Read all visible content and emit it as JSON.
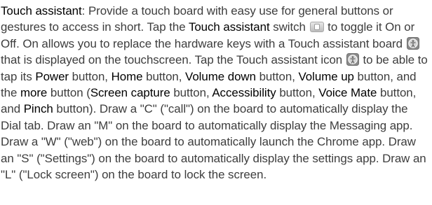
{
  "segments": [
    {
      "t": "Touch assistant",
      "term": true
    },
    {
      "t": ": Provide a touch board with easy use for general buttons or gestures to access in short. Tap the "
    },
    {
      "t": "Touch assistant",
      "term": true
    },
    {
      "t": " switch "
    },
    {
      "icon": "toggle-switch-icon"
    },
    {
      "t": " to toggle it On or Off. On allows you to replace the hardware keys with a Touch assistant board "
    },
    {
      "icon": "touch-assistant-icon"
    },
    {
      "t": " that is displayed on the touchscreen. Tap the Touch assistant icon "
    },
    {
      "icon": "touch-assistant-icon"
    },
    {
      "t": " to be able to tap its "
    },
    {
      "t": "Power",
      "term": true
    },
    {
      "t": " button, "
    },
    {
      "t": "Home",
      "term": true
    },
    {
      "t": " button, "
    },
    {
      "t": "Volume down",
      "term": true
    },
    {
      "t": " button, "
    },
    {
      "t": "Volume up",
      "term": true
    },
    {
      "t": " button, and the "
    },
    {
      "t": "more",
      "term": true
    },
    {
      "t": " button ("
    },
    {
      "t": "Screen capture",
      "term": true
    },
    {
      "t": " button, "
    },
    {
      "t": "Accessibility",
      "term": true
    },
    {
      "t": " button, "
    },
    {
      "t": "Voice Mate",
      "term": true
    },
    {
      "t": " button, and "
    },
    {
      "t": "Pinch",
      "term": true
    },
    {
      "t": " button). Draw a \"C\" (\"call\") on the board to automatically display the Dial tab. Draw an \"M\" on the board to automatically display the Messaging app. Draw a \"W\" (\"web\") on the board to automatically launch the Chrome app. Draw an \"S\" (\"Settings\") on the board to automatically display the settings app. Draw an \"L\" (\"Lock screen\") on the board to lock the screen."
    }
  ]
}
